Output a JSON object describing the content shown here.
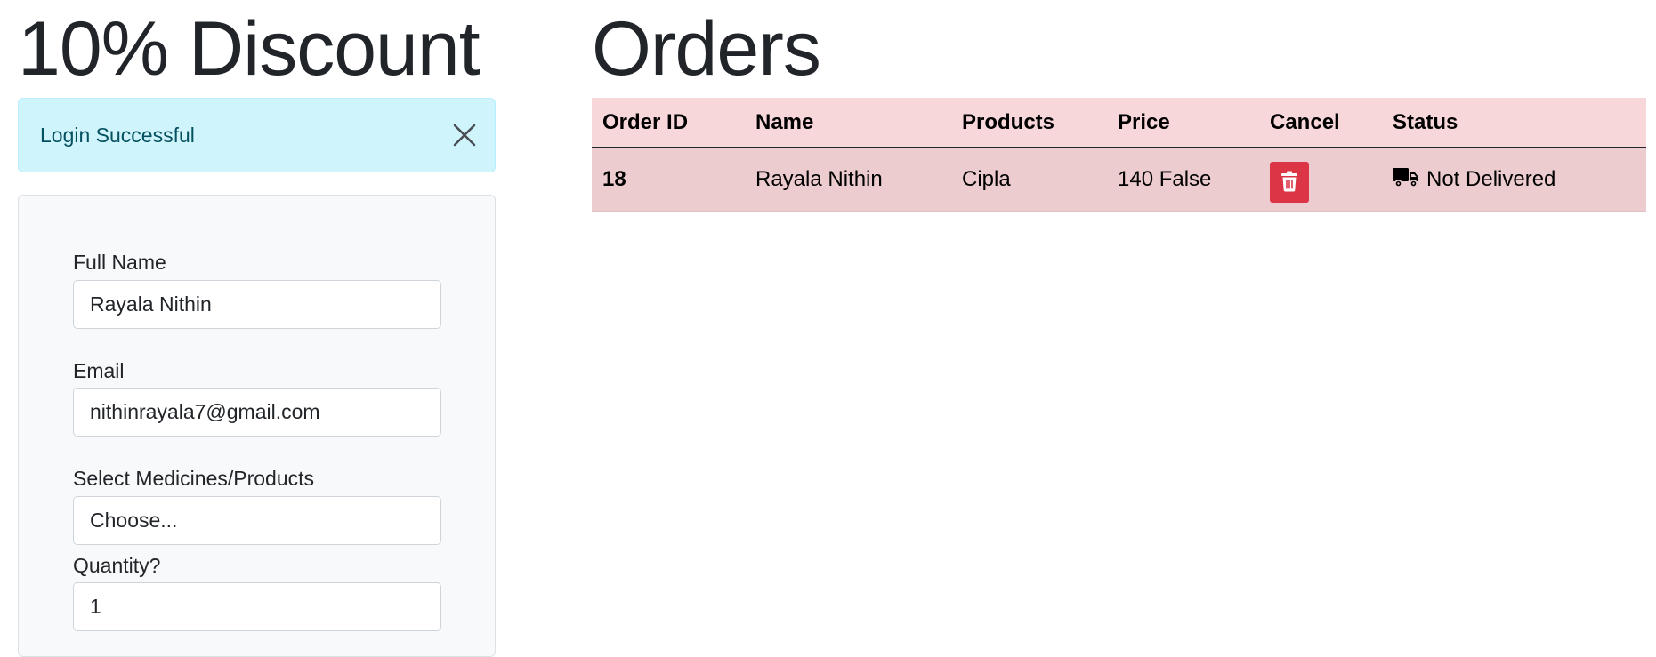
{
  "discount": {
    "title": "10% Discount"
  },
  "alert": {
    "message": "Login Successful"
  },
  "form": {
    "full_name_label": "Full Name",
    "full_name_value": "Rayala Nithin",
    "email_label": "Email",
    "email_value": "nithinrayala7@gmail.com",
    "products_label": "Select Medicines/Products",
    "products_selected": "Choose...",
    "quantity_label": "Quantity?",
    "quantity_value": "1"
  },
  "orders": {
    "title": "Orders",
    "columns": [
      "Order ID",
      "Name",
      "Products",
      "Price",
      "Cancel",
      "Status"
    ],
    "rows": [
      {
        "order_id": "18",
        "name": "Rayala Nithin",
        "products": "Cipla",
        "price": "140 False",
        "status": "Not Delivered"
      }
    ]
  },
  "icons": {
    "close": "close-icon",
    "delete": "trash-icon",
    "status": "truck-icon"
  },
  "colors": {
    "alert_bg": "#cff4fc",
    "table_head_bg": "#f8d7da",
    "table_row_bg": "#eccccf",
    "delete_button": "#dc3545"
  }
}
